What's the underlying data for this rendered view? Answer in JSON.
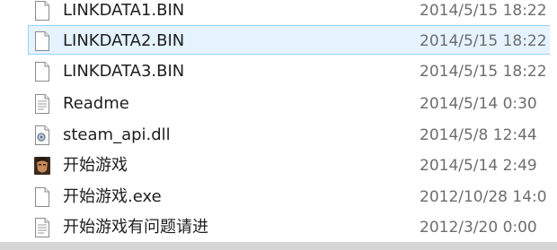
{
  "files": [
    {
      "name": "LINKDATA1.BIN",
      "date": "2014/5/15 18:22",
      "icon": "blank-file-icon",
      "selected": false
    },
    {
      "name": "LINKDATA2.BIN",
      "date": "2014/5/15 18:22",
      "icon": "blank-file-icon",
      "selected": true
    },
    {
      "name": "LINKDATA3.BIN",
      "date": "2014/5/15 18:22",
      "icon": "blank-file-icon",
      "selected": false
    },
    {
      "name": "Readme",
      "date": "2014/5/14 0:30",
      "icon": "text-file-icon",
      "selected": false
    },
    {
      "name": "steam_api.dll",
      "date": "2014/5/8 12:44",
      "icon": "dll-file-icon",
      "selected": false
    },
    {
      "name": "开始游戏",
      "date": "2014/5/14 2:49",
      "icon": "game-app-icon",
      "selected": false
    },
    {
      "name": "开始游戏.exe",
      "date": "2012/10/28 14:0",
      "icon": "blank-file-icon",
      "selected": false
    },
    {
      "name": "开始游戏有问题请进",
      "date": "2012/3/20 0:00",
      "icon": "text-file-icon",
      "selected": false
    }
  ],
  "colors": {
    "selection_fill": "#e5f3ff",
    "selection_border": "#99d1ff",
    "date_text": "#6d6d6d"
  }
}
